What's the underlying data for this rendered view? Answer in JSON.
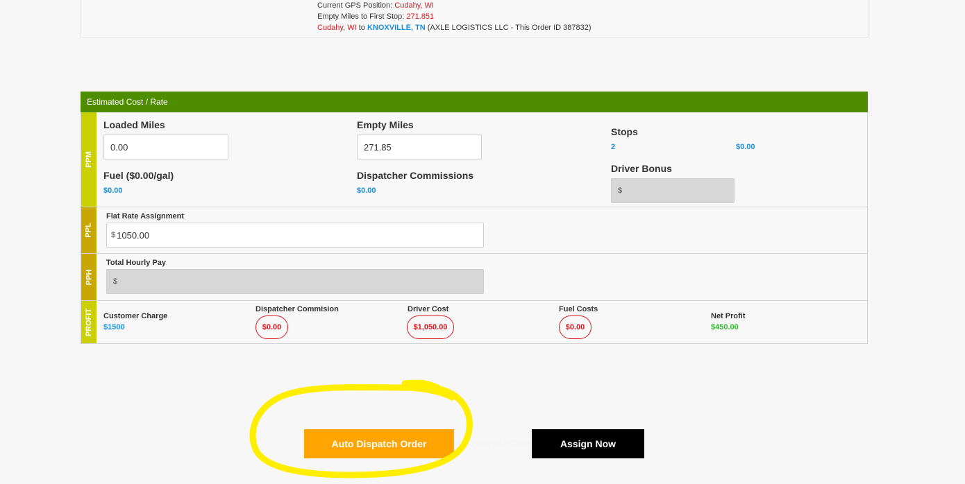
{
  "route": {
    "gps_label": "Current GPS Position:",
    "gps_value": "Cudahy, WI",
    "empty_label": "Empty Miles to First Stop:",
    "empty_value": "271.851",
    "from": "Cudahy, WI",
    "to_word": "to",
    "dest": "KNOXVILLE, TN",
    "info": "(AXLE LOGISTICS LLC - This Order ID 387832)"
  },
  "estimate": {
    "title": "Estimated Cost / Rate",
    "ppm": {
      "side_label": "PPM",
      "loaded_miles_label": "Loaded Miles",
      "loaded_miles_value": "0.00",
      "empty_miles_label": "Empty Miles",
      "empty_miles_value": "271.85",
      "stops_label": "Stops",
      "stops_count": "2",
      "stops_amount": "$0.00",
      "fuel_label": "Fuel ($0.00/gal)",
      "fuel_value": "$0.00",
      "dispatcher_label": "Dispatcher Commissions",
      "dispatcher_value": "$0.00",
      "bonus_label": "Driver Bonus",
      "bonus_currency": "$"
    },
    "ppl": {
      "side_label": "PPL",
      "flat_label": "Flat Rate Assignment",
      "flat_currency": "$",
      "flat_value": "1050.00"
    },
    "pph": {
      "side_label": "PPH",
      "hourly_label": "Total Hourly Pay",
      "hourly_currency": "$"
    },
    "profit": {
      "side_label": "PROFIT",
      "customer_label": "Customer Charge",
      "customer_value": "$1500",
      "dispatcher_label": "Dispatcher Commision",
      "dispatcher_value": "$0.00",
      "driver_label": "Driver Cost",
      "driver_value": "$1,050.00",
      "fuel_label": "Fuel Costs",
      "fuel_value": "$0.00",
      "net_label": "Net Profit",
      "net_value": "$450.00"
    }
  },
  "actions": {
    "auto_dispatch": "Auto Dispatch Order",
    "ghost_text": "Auto Dispatch Order",
    "assign_now": "Assign Now"
  },
  "colors": {
    "header_green": "#4e8c00",
    "accent_orange": "#ffa401",
    "highlight_yellow": "#ffee00"
  }
}
